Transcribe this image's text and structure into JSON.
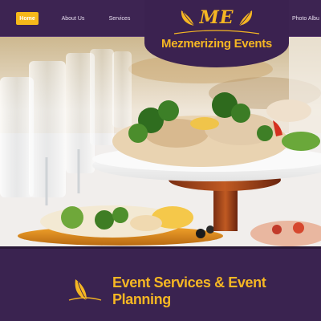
{
  "nav": {
    "items": [
      {
        "label": "Home",
        "active": true
      },
      {
        "label": "About Us",
        "active": false
      },
      {
        "label": "Services",
        "active": false
      },
      {
        "label": "Photo Albu",
        "active": false
      }
    ]
  },
  "logo": {
    "initials": "ME",
    "name": "Mezmerizing Events"
  },
  "hero": {
    "image": "catering-food-platter-photo"
  },
  "section": {
    "title": "Event Services & Event Planning",
    "icon": "lotus-leaf-icon"
  },
  "colors": {
    "brand_purple": "#3a2350",
    "accent_gold": "#f5b623",
    "nav_text": "#e8dff0"
  }
}
